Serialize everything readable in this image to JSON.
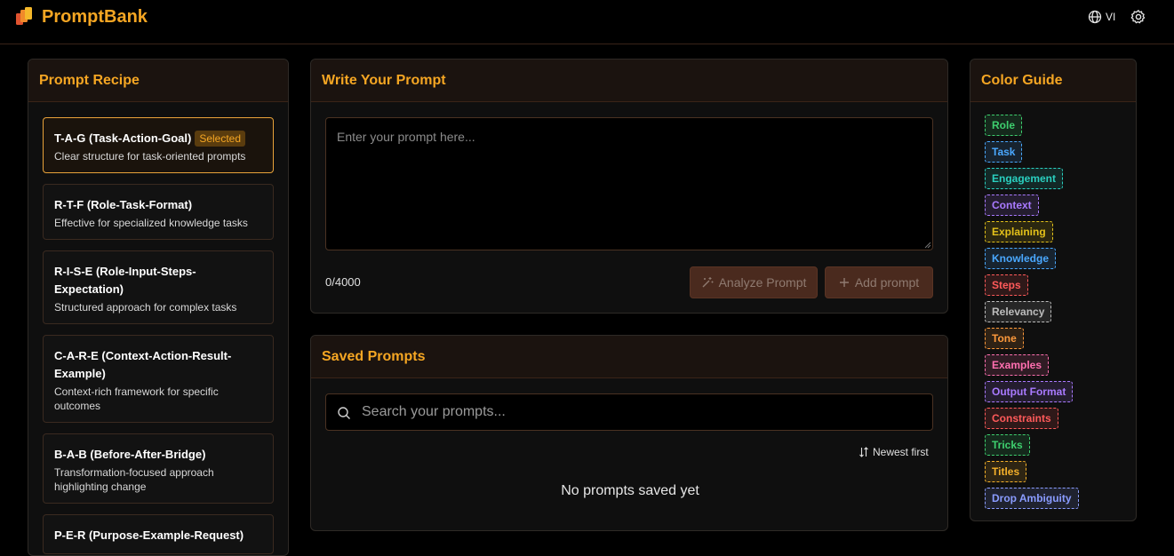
{
  "header": {
    "brand": "PromptBank",
    "lang": "VI"
  },
  "recipe": {
    "title": "Prompt Recipe",
    "selected_badge": "Selected",
    "items": [
      {
        "title": "T-A-G (Task-Action-Goal)",
        "desc": "Clear structure for task-oriented prompts",
        "selected": true
      },
      {
        "title": "R-T-F (Role-Task-Format)",
        "desc": "Effective for specialized knowledge tasks"
      },
      {
        "title": "R-I-S-E (Role-Input-Steps-Expectation)",
        "desc": "Structured approach for complex tasks"
      },
      {
        "title": "C-A-R-E (Context-Action-Result-Example)",
        "desc": "Context-rich framework for specific outcomes"
      },
      {
        "title": "B-A-B (Before-After-Bridge)",
        "desc": "Transformation-focused approach highlighting change"
      },
      {
        "title": "P-E-R (Purpose-Example-Request)",
        "desc": ""
      }
    ]
  },
  "write": {
    "title": "Write Your Prompt",
    "placeholder": "Enter your prompt here...",
    "counter": "0/4000",
    "analyze_label": "Analyze Prompt",
    "add_label": "Add prompt"
  },
  "saved": {
    "title": "Saved Prompts",
    "search_placeholder": "Search your prompts...",
    "sort_label": "Newest first",
    "empty": "No prompts saved yet"
  },
  "guide": {
    "title": "Color Guide",
    "tags": [
      {
        "label": "Role",
        "color": "#3ecf6e"
      },
      {
        "label": "Task",
        "color": "#4aa8ff"
      },
      {
        "label": "Engagement",
        "color": "#2ad0c0"
      },
      {
        "label": "Context",
        "color": "#a97aff"
      },
      {
        "label": "Explaining",
        "color": "#e3c11a"
      },
      {
        "label": "Knowledge",
        "color": "#4aa8ff"
      },
      {
        "label": "Steps",
        "color": "#ff5a5a"
      },
      {
        "label": "Relevancy",
        "color": "#bdbdbd"
      },
      {
        "label": "Tone",
        "color": "#ff9a3c"
      },
      {
        "label": "Examples",
        "color": "#ff6fb0"
      },
      {
        "label": "Output Format",
        "color": "#a97aff"
      },
      {
        "label": "Constraints",
        "color": "#ff5a5a"
      },
      {
        "label": "Tricks",
        "color": "#3ecf6e"
      },
      {
        "label": "Titles",
        "color": "#f5b12a"
      },
      {
        "label": "Drop Ambiguity",
        "color": "#8a9cff"
      }
    ]
  },
  "colors": {
    "accent": "#f5a623"
  }
}
